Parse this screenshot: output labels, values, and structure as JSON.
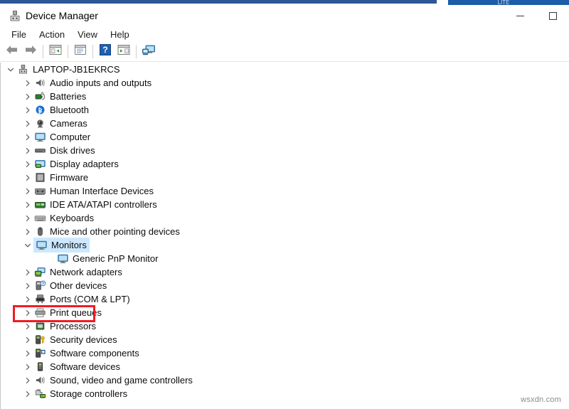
{
  "window": {
    "title": "Device Manager",
    "title_icon": "device-manager-icon",
    "minimize_label": "Minimize",
    "maximize_label": "Maximize",
    "top_strip_fragment_text": "LITE"
  },
  "menu": {
    "items": [
      {
        "label": "File",
        "name": "menu-file"
      },
      {
        "label": "Action",
        "name": "menu-action"
      },
      {
        "label": "View",
        "name": "menu-view"
      },
      {
        "label": "Help",
        "name": "menu-help"
      }
    ]
  },
  "toolbar": {
    "buttons": [
      {
        "name": "back-arrow-icon",
        "tooltip": "Back"
      },
      {
        "name": "forward-arrow-icon",
        "tooltip": "Forward"
      },
      {
        "name": "separator-1",
        "tooltip": ""
      },
      {
        "name": "show-hide-console-tree-icon",
        "tooltip": "Show/Hide Console Tree"
      },
      {
        "name": "separator-2",
        "tooltip": ""
      },
      {
        "name": "properties-icon",
        "tooltip": "Properties"
      },
      {
        "name": "separator-3",
        "tooltip": ""
      },
      {
        "name": "help-icon",
        "tooltip": "Help"
      },
      {
        "name": "update-driver-icon",
        "tooltip": "Update Driver Software"
      },
      {
        "name": "separator-4",
        "tooltip": ""
      },
      {
        "name": "scan-hardware-changes-icon",
        "tooltip": "Scan for hardware changes"
      }
    ]
  },
  "tree": {
    "rows": [
      {
        "label": "LAPTOP-JB1EKRCS",
        "level": 0,
        "state": "expanded",
        "icon": "computer-node-icon",
        "selected": false
      },
      {
        "label": "Audio inputs and outputs",
        "level": 1,
        "state": "collapsed",
        "icon": "speaker-icon",
        "selected": false
      },
      {
        "label": "Batteries",
        "level": 1,
        "state": "collapsed",
        "icon": "battery-icon",
        "selected": false
      },
      {
        "label": "Bluetooth",
        "level": 1,
        "state": "collapsed",
        "icon": "bluetooth-icon",
        "selected": false
      },
      {
        "label": "Cameras",
        "level": 1,
        "state": "collapsed",
        "icon": "camera-icon",
        "selected": false
      },
      {
        "label": "Computer",
        "level": 1,
        "state": "collapsed",
        "icon": "monitor-icon",
        "selected": false
      },
      {
        "label": "Disk drives",
        "level": 1,
        "state": "collapsed",
        "icon": "disk-drive-icon",
        "selected": false
      },
      {
        "label": "Display adapters",
        "level": 1,
        "state": "collapsed",
        "icon": "display-adapter-icon",
        "selected": false
      },
      {
        "label": "Firmware",
        "level": 1,
        "state": "collapsed",
        "icon": "firmware-chip-icon",
        "selected": false
      },
      {
        "label": "Human Interface Devices",
        "level": 1,
        "state": "collapsed",
        "icon": "hid-icon",
        "selected": false
      },
      {
        "label": "IDE ATA/ATAPI controllers",
        "level": 1,
        "state": "collapsed",
        "icon": "ide-controller-icon",
        "selected": false
      },
      {
        "label": "Keyboards",
        "level": 1,
        "state": "collapsed",
        "icon": "keyboard-icon",
        "selected": false
      },
      {
        "label": "Mice and other pointing devices",
        "level": 1,
        "state": "collapsed",
        "icon": "mouse-icon",
        "selected": false
      },
      {
        "label": "Monitors",
        "level": 1,
        "state": "expanded",
        "icon": "monitor-icon",
        "selected": true
      },
      {
        "label": "Generic PnP Monitor",
        "level": 2,
        "state": "leaf",
        "icon": "monitor-icon",
        "selected": false
      },
      {
        "label": "Network adapters",
        "level": 1,
        "state": "collapsed",
        "icon": "network-adapter-icon",
        "selected": false
      },
      {
        "label": "Other devices",
        "level": 1,
        "state": "collapsed",
        "icon": "other-device-icon",
        "selected": false
      },
      {
        "label": "Ports (COM & LPT)",
        "level": 1,
        "state": "collapsed",
        "icon": "port-icon",
        "selected": false
      },
      {
        "label": "Print queues",
        "level": 1,
        "state": "collapsed",
        "icon": "printer-icon",
        "selected": false
      },
      {
        "label": "Processors",
        "level": 1,
        "state": "collapsed",
        "icon": "processor-icon",
        "selected": false
      },
      {
        "label": "Security devices",
        "level": 1,
        "state": "collapsed",
        "icon": "security-device-icon",
        "selected": false
      },
      {
        "label": "Software components",
        "level": 1,
        "state": "collapsed",
        "icon": "software-component-icon",
        "selected": false
      },
      {
        "label": "Software devices",
        "level": 1,
        "state": "collapsed",
        "icon": "software-device-icon",
        "selected": false
      },
      {
        "label": "Sound, video and game controllers",
        "level": 1,
        "state": "collapsed",
        "icon": "speaker-icon",
        "selected": false
      },
      {
        "label": "Storage controllers",
        "level": 1,
        "state": "collapsed",
        "icon": "storage-controller-icon",
        "selected": false
      }
    ]
  },
  "annotation": {
    "type": "highlight-rectangle",
    "target": "Monitors",
    "color": "#ee1d24"
  },
  "watermark": {
    "text": "wsxdn.com"
  },
  "colors": {
    "selection": "#cce8ff",
    "annotation_red": "#ee1d24",
    "title_strip_blue": "#2b5797"
  }
}
